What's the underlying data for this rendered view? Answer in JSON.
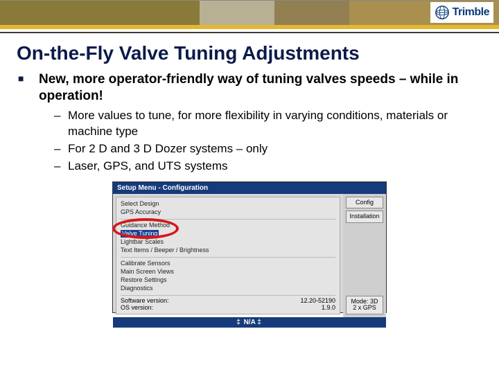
{
  "brand": {
    "name": "Trimble"
  },
  "slide": {
    "title": "On-the-Fly Valve Tuning Adjustments",
    "bullet1": "New, more operator-friendly way of tuning valves speeds – while in operation!",
    "subbullets": [
      "More values to tune, for more flexibility in varying conditions, materials or machine type",
      "For 2 D and 3 D Dozer systems – only",
      "Laser, GPS, and UTS systems"
    ]
  },
  "embed": {
    "titlebar": "Setup Menu - Configuration",
    "items": {
      "select_design": "Select Design",
      "gps_accuracy": "GPS Accuracy",
      "guidance_method": "Guidance Method",
      "valve_tuning": "Valve Tuning",
      "lightbar_scales": "Lightbar Scales",
      "text_brightness": "Text Items / Beeper / Brightness",
      "calibrate_sensors": "Calibrate Sensors",
      "main_screen_views": "Main Screen Views",
      "restore_settings": "Restore Settings",
      "diagnostics": "Diagnostics"
    },
    "versions": {
      "sw_label": "Software version:",
      "sw_value": "12.20-52190",
      "os_label": "OS version:",
      "os_value": "1.9.0"
    },
    "buttons": {
      "config": "Config",
      "installation": "Installation",
      "mode": "Mode: 3D\n2 x GPS"
    },
    "footer": "N/A"
  }
}
